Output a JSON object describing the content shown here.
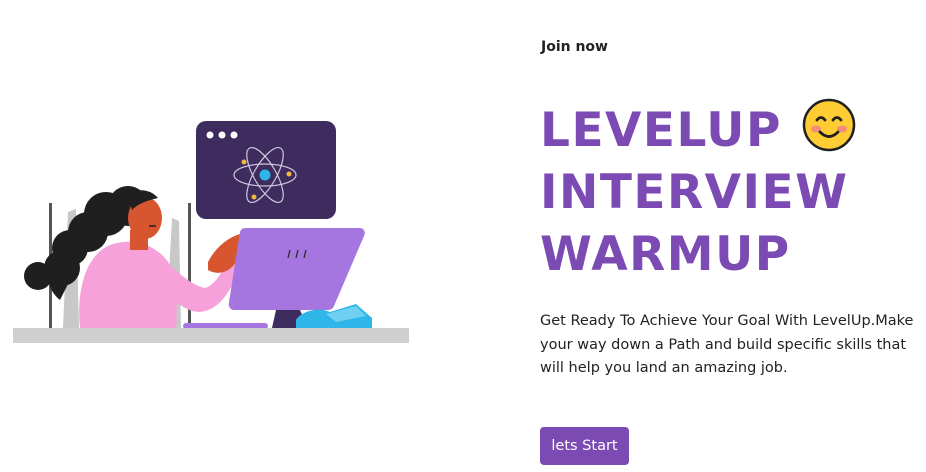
{
  "nav": {
    "join_label": "Join now"
  },
  "hero": {
    "headline_lines": [
      "LEVELUP",
      "INTERVIEW",
      "WARMUP"
    ],
    "description": "Get Ready To Achieve Your Goal With LevelUp.Make your way down a Path and build specific skills that will help you land an amazing job.",
    "cta_label": "lets Start"
  },
  "colors": {
    "brand_purple": "#7b4ab3",
    "text_dark": "#222222",
    "background": "#ffffff"
  },
  "icons": {
    "emoji": "smiling-face-emoji-icon",
    "illustration": "woman-at-computer-illustration"
  }
}
